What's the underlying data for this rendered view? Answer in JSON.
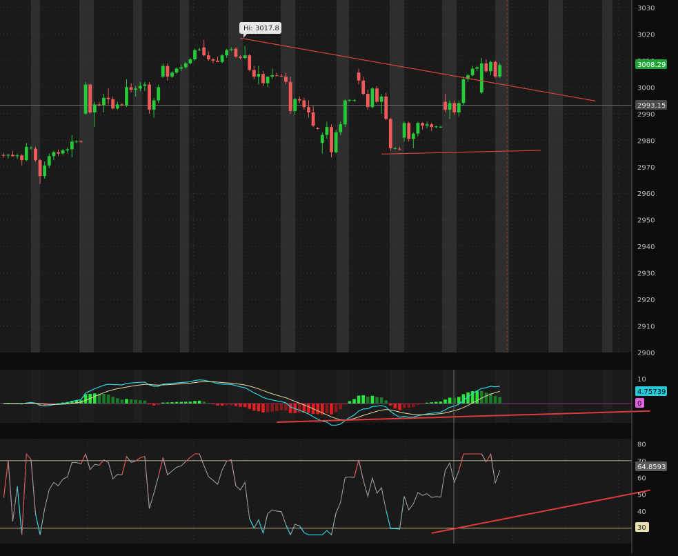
{
  "chart_data": [
    {
      "type": "candlestick",
      "panel": "price",
      "ylim": [
        2900,
        3030
      ],
      "y_ticks": [
        2900,
        2910,
        2920,
        2930,
        2940,
        2950,
        2960,
        2970,
        2980,
        2990,
        3000,
        3010,
        3020,
        3030
      ],
      "y_tick_labels": [
        "2900",
        "2910",
        "2920",
        "2930",
        "2940",
        "2950",
        "2960",
        "2970",
        "2980",
        "2990",
        "3000",
        "3010",
        "3020",
        "3030"
      ],
      "last_price": 3008.29,
      "last_price_label": "3008.29",
      "reference_price": 2993.15,
      "reference_price_label": "2993.15",
      "high_annotation": "Hi: 3017.8",
      "high_value": 3017.8,
      "trendlines": [
        {
          "from": [
            52,
            3018.5
          ],
          "to": [
            130,
            2994.8
          ]
        },
        {
          "from": [
            83,
            2974.8
          ],
          "to": [
            118,
            2976.2
          ]
        }
      ],
      "candles": [
        [
          2974.5,
          2975.3,
          2973.5,
          2974.2
        ],
        [
          2974.2,
          2974.8,
          2973.2,
          2974.5
        ],
        [
          2974.5,
          2976.0,
          2973.8,
          2974.0
        ],
        [
          2974.0,
          2975.0,
          2973.0,
          2974.3
        ],
        [
          2974.3,
          2974.8,
          2970.5,
          2972.5
        ],
        [
          2972.5,
          2979.0,
          2972.0,
          2977.5
        ],
        [
          2977.0,
          2977.8,
          2976.5,
          2977.2
        ],
        [
          2976.8,
          2977.5,
          2972.0,
          2972.5
        ],
        [
          2972.5,
          2973.0,
          2963.5,
          2966.5
        ],
        [
          2966.5,
          2972.0,
          2965.5,
          2970.5
        ],
        [
          2970.5,
          2975.0,
          2969.5,
          2974.0
        ],
        [
          2974.0,
          2976.0,
          2972.5,
          2975.5
        ],
        [
          2975.5,
          2976.5,
          2974.0,
          2975.0
        ],
        [
          2975.0,
          2976.8,
          2974.5,
          2976.2
        ],
        [
          2976.2,
          2977.3,
          2975.3,
          2976.6
        ],
        [
          2976.6,
          2982.0,
          2973.5,
          2979.5
        ],
        [
          2979.5,
          2980.0,
          2978.9,
          2979.5
        ],
        [
          2979.5,
          2980.0,
          2979.0,
          2979.4
        ],
        [
          2990.0,
          3002.0,
          2989.5,
          3001.0
        ],
        [
          3001.0,
          3001.5,
          2990.0,
          2990.5
        ],
        [
          2990.5,
          2994.5,
          2985.0,
          2993.5
        ],
        [
          2993.5,
          2994.5,
          2992.8,
          2993.3
        ],
        [
          2993.3,
          2997.5,
          2990.5,
          2996.0
        ],
        [
          2996.0,
          2999.5,
          2993.5,
          2995.5
        ],
        [
          2995.5,
          2996.5,
          2991.5,
          2992.0
        ],
        [
          2992.0,
          2994.5,
          2991.5,
          2993.5
        ],
        [
          2993.5,
          2994.0,
          2992.8,
          2993.4
        ],
        [
          2993.0,
          3003.0,
          2992.5,
          3000.0
        ],
        [
          3000.0,
          3001.5,
          2998.0,
          2999.0
        ],
        [
          2999.0,
          3000.5,
          2996.5,
          2999.5
        ],
        [
          2999.5,
          3002.0,
          2998.5,
          3000.5
        ],
        [
          3000.5,
          3002.0,
          2998.5,
          3001.0
        ],
        [
          3001.0,
          3002.0,
          2990.0,
          2991.5
        ],
        [
          2991.5,
          2996.0,
          2988.5,
          2995.0
        ],
        [
          2995.0,
          3001.0,
          2994.0,
          3000.0
        ],
        [
          3004.0,
          3009.0,
          3003.5,
          3008.0
        ],
        [
          3008.0,
          3009.0,
          3002.5,
          3004.0
        ],
        [
          3004.0,
          3006.0,
          3003.5,
          3005.5
        ],
        [
          3005.5,
          3007.5,
          3005.0,
          3007.0
        ],
        [
          3007.0,
          3008.5,
          3006.0,
          3007.5
        ],
        [
          3007.5,
          3009.5,
          3007.0,
          3009.0
        ],
        [
          3009.0,
          3011.0,
          3008.5,
          3010.5
        ],
        [
          3010.5,
          3014.5,
          3010.0,
          3014.0
        ],
        [
          3014.0,
          3014.8,
          3013.6,
          3014.2
        ],
        [
          3015.0,
          3017.8,
          3011.5,
          3012.0
        ],
        [
          3012.0,
          3013.5,
          3010.0,
          3010.5
        ],
        [
          3010.5,
          3011.0,
          3009.0,
          3010.0
        ],
        [
          3010.0,
          3011.5,
          3009.5,
          3009.5
        ],
        [
          3009.5,
          3012.5,
          3009.0,
          3012.0
        ],
        [
          3012.0,
          3014.5,
          3011.0,
          3014.0
        ],
        [
          3014.0,
          3015.0,
          3013.5,
          3014.3
        ],
        [
          3014.5,
          3015.0,
          3011.0,
          3011.5
        ],
        [
          3011.5,
          3012.0,
          3010.5,
          3011.0
        ],
        [
          3011.0,
          3015.5,
          3010.5,
          3012.0
        ],
        [
          3012.0,
          3012.5,
          3006.0,
          3006.5
        ],
        [
          3006.5,
          3008.0,
          3003.0,
          3004.0
        ],
        [
          3004.0,
          3008.0,
          3001.0,
          3005.0
        ],
        [
          3005.0,
          3006.0,
          3000.5,
          3001.5
        ],
        [
          3001.5,
          3004.0,
          3000.0,
          3004.0
        ],
        [
          3004.0,
          3007.0,
          3003.0,
          3004.5
        ],
        [
          3004.5,
          3005.5,
          3004.0,
          3004.3
        ],
        [
          3004.3,
          3005.0,
          3003.8,
          3004.2
        ],
        [
          3004.0,
          3005.5,
          3001.0,
          3002.0
        ],
        [
          3002.0,
          3004.0,
          2990.0,
          2991.0
        ],
        [
          2991.0,
          2996.0,
          2989.5,
          2995.5
        ],
        [
          2995.5,
          2996.5,
          2994.0,
          2995.0
        ],
        [
          2995.0,
          2996.0,
          2991.5,
          2992.5
        ],
        [
          2992.5,
          2995.0,
          2988.5,
          2990.5
        ],
        [
          2990.5,
          2993.0,
          2985.0,
          2985.5
        ],
        [
          2984.5,
          2985.0,
          2984.0,
          2984.4
        ],
        [
          2979.0,
          2983.0,
          2975.0,
          2982.0
        ],
        [
          2982.0,
          2987.0,
          2980.5,
          2985.0
        ],
        [
          2985.0,
          2986.0,
          2973.5,
          2975.5
        ],
        [
          2975.5,
          2984.0,
          2975.0,
          2983.0
        ],
        [
          2983.0,
          2987.0,
          2982.0,
          2986.0
        ],
        [
          2986.0,
          2995.5,
          2985.0,
          2995.0
        ],
        [
          2995.0,
          2995.5,
          2994.5,
          2995.2
        ],
        [
          2995.0,
          2995.5,
          2994.5,
          2995.1
        ],
        [
          3005.5,
          3007.0,
          3001.0,
          3002.5
        ],
        [
          3002.5,
          3004.0,
          2997.0,
          2997.5
        ],
        [
          2997.5,
          2999.0,
          2991.5,
          2992.5
        ],
        [
          2992.5,
          3000.0,
          2992.0,
          2999.5
        ],
        [
          2999.5,
          3000.5,
          2994.0,
          2994.5
        ],
        [
          2994.5,
          2997.5,
          2990.0,
          2996.5
        ],
        [
          2996.5,
          2998.0,
          2987.5,
          2988.0
        ],
        [
          2988.0,
          2988.5,
          2976.0,
          2977.0
        ],
        [
          2977.0,
          2977.5,
          2976.5,
          2977.0
        ],
        [
          2976.8,
          2977.5,
          2976.2,
          2976.7
        ],
        [
          2981.0,
          2987.0,
          2979.5,
          2986.5
        ],
        [
          2986.5,
          2987.0,
          2979.5,
          2980.5
        ],
        [
          2980.5,
          2983.0,
          2977.0,
          2982.5
        ],
        [
          2982.5,
          2987.0,
          2981.5,
          2986.5
        ],
        [
          2986.5,
          2986.8,
          2984.0,
          2985.5
        ],
        [
          2985.5,
          2987.0,
          2984.5,
          2986.0
        ],
        [
          2986.0,
          2986.5,
          2983.5,
          2985.0
        ],
        [
          2985.0,
          2985.5,
          2984.5,
          2985.2
        ],
        [
          2985.0,
          2985.5,
          2984.5,
          2985.1
        ],
        [
          2994.5,
          2997.5,
          2990.5,
          2991.5
        ],
        [
          2991.5,
          2995.0,
          2988.0,
          2994.0
        ],
        [
          2994.0,
          2995.0,
          2989.5,
          2990.5
        ],
        [
          2990.5,
          2995.0,
          2989.0,
          2994.0
        ],
        [
          2994.0,
          3004.0,
          2993.0,
          3003.0
        ],
        [
          3003.0,
          3005.0,
          3002.0,
          3004.5
        ],
        [
          3004.5,
          3008.0,
          3004.0,
          3007.0
        ],
        [
          3007.0,
          3008.0,
          3006.0,
          3007.5
        ],
        [
          2998.0,
          3011.0,
          2997.5,
          3009.0
        ],
        [
          3009.0,
          3010.5,
          3005.5,
          3006.0
        ],
        [
          3006.0,
          3010.0,
          3004.5,
          3009.5
        ],
        [
          3009.5,
          3010.0,
          3003.5,
          3004.0
        ],
        [
          3004.0,
          3009.0,
          3003.5,
          3008.3
        ]
      ]
    },
    {
      "type": "line",
      "panel": "macd",
      "y_ticks": [
        10,
        0
      ],
      "y_tick_labels": [
        "10"
      ],
      "macd_value_label": "4.75739",
      "zero_label": "0",
      "divergence_line": {
        "from": [
          60,
          -7.5
        ],
        "to": [
          142,
          -3.0
        ]
      }
    },
    {
      "type": "line",
      "panel": "rsi",
      "ylim": [
        20,
        85
      ],
      "y_ticks": [
        80,
        70,
        60,
        50,
        40
      ],
      "y_tick_labels": [
        "80",
        "70",
        "60",
        "50",
        "40"
      ],
      "overbought": 70,
      "oversold": 30,
      "oversold_label": "30",
      "rsi_value_label": "64.8593",
      "divergence_line": {
        "from": [
          94,
          27.0
        ],
        "to": [
          142,
          52.5
        ]
      }
    }
  ]
}
